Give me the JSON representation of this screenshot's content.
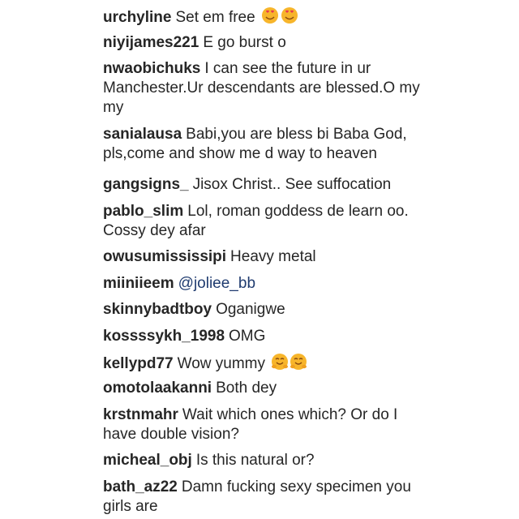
{
  "comments": [
    {
      "username": "urchyline",
      "text": "Set em free",
      "emoji": "smiling-heart-eyes-face-icon"
    },
    {
      "username": "niyijames221",
      "text": "E go burst o"
    },
    {
      "username": "nwaobichuks",
      "text": "I can see the future in ur Manchester.Ur descendants are blessed.O my my"
    },
    {
      "username": "sanialausa",
      "text": "Babi,you are bless bi Baba God, pls,come and show me d way to heaven"
    },
    {
      "username": "gangsigns_",
      "text": "Jisox Christ.. See suffocation"
    },
    {
      "username": "pablo_slim",
      "text": "Lol, roman goddess de learn oo. Cossy dey afar"
    },
    {
      "username": "owusumississipi",
      "text": "Heavy metal"
    },
    {
      "username": "miiniieem",
      "text": "@joliee_bb"
    },
    {
      "username": "skinnybadtboy",
      "text": "Oganigwe"
    },
    {
      "username": "kossssykh_1998",
      "text": "OMG"
    },
    {
      "username": "kellypd77",
      "text": "Wow yummy",
      "emoji": "hugging-face-icon"
    },
    {
      "username": "omotolaakanni",
      "text": "Both dey"
    },
    {
      "username": "krstnmahr",
      "text": "Wait which ones which? Or do I have double vision?"
    },
    {
      "username": "micheal_obj",
      "text": "Is this natural or?"
    },
    {
      "username": "bath_az22",
      "text": "Damn fucking sexy specimen you girls are"
    }
  ],
  "colors": {
    "text": "#262626",
    "mention": "#1f3b6f",
    "emoji_face": "#f7b52b"
  }
}
